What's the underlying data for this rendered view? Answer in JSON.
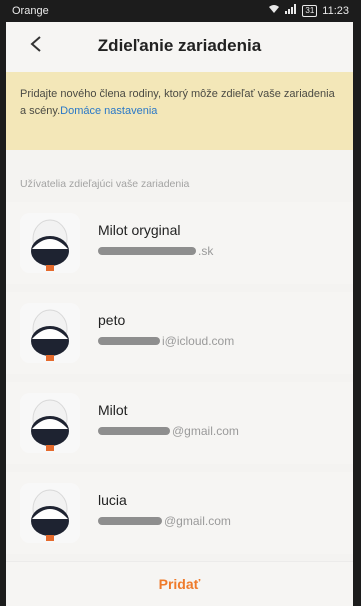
{
  "status": {
    "carrier": "Orange",
    "battery": "31",
    "time": "11:23"
  },
  "header": {
    "title": "Zdieľanie zariadenia"
  },
  "notice": {
    "text": "Pridajte nového člena rodiny, ktorý môže zdieľať vaše zariadenia a scény.",
    "link": "Domáce nastavenia"
  },
  "section": {
    "label": "Užívatelia zdieľajúci vaše zariadenia"
  },
  "users": [
    {
      "name": "Milot oryginal",
      "email_suffix": ".sk"
    },
    {
      "name": "peto",
      "email_suffix": "i@icloud.com"
    },
    {
      "name": "Milot",
      "email_suffix": "@gmail.com"
    },
    {
      "name": "lucia",
      "email_suffix": "@gmail.com"
    }
  ],
  "footer": {
    "add_label": "Pridať"
  },
  "colors": {
    "accent": "#ef7a2a",
    "link": "#2a78c7",
    "notice_bg": "#f3e7b8"
  }
}
